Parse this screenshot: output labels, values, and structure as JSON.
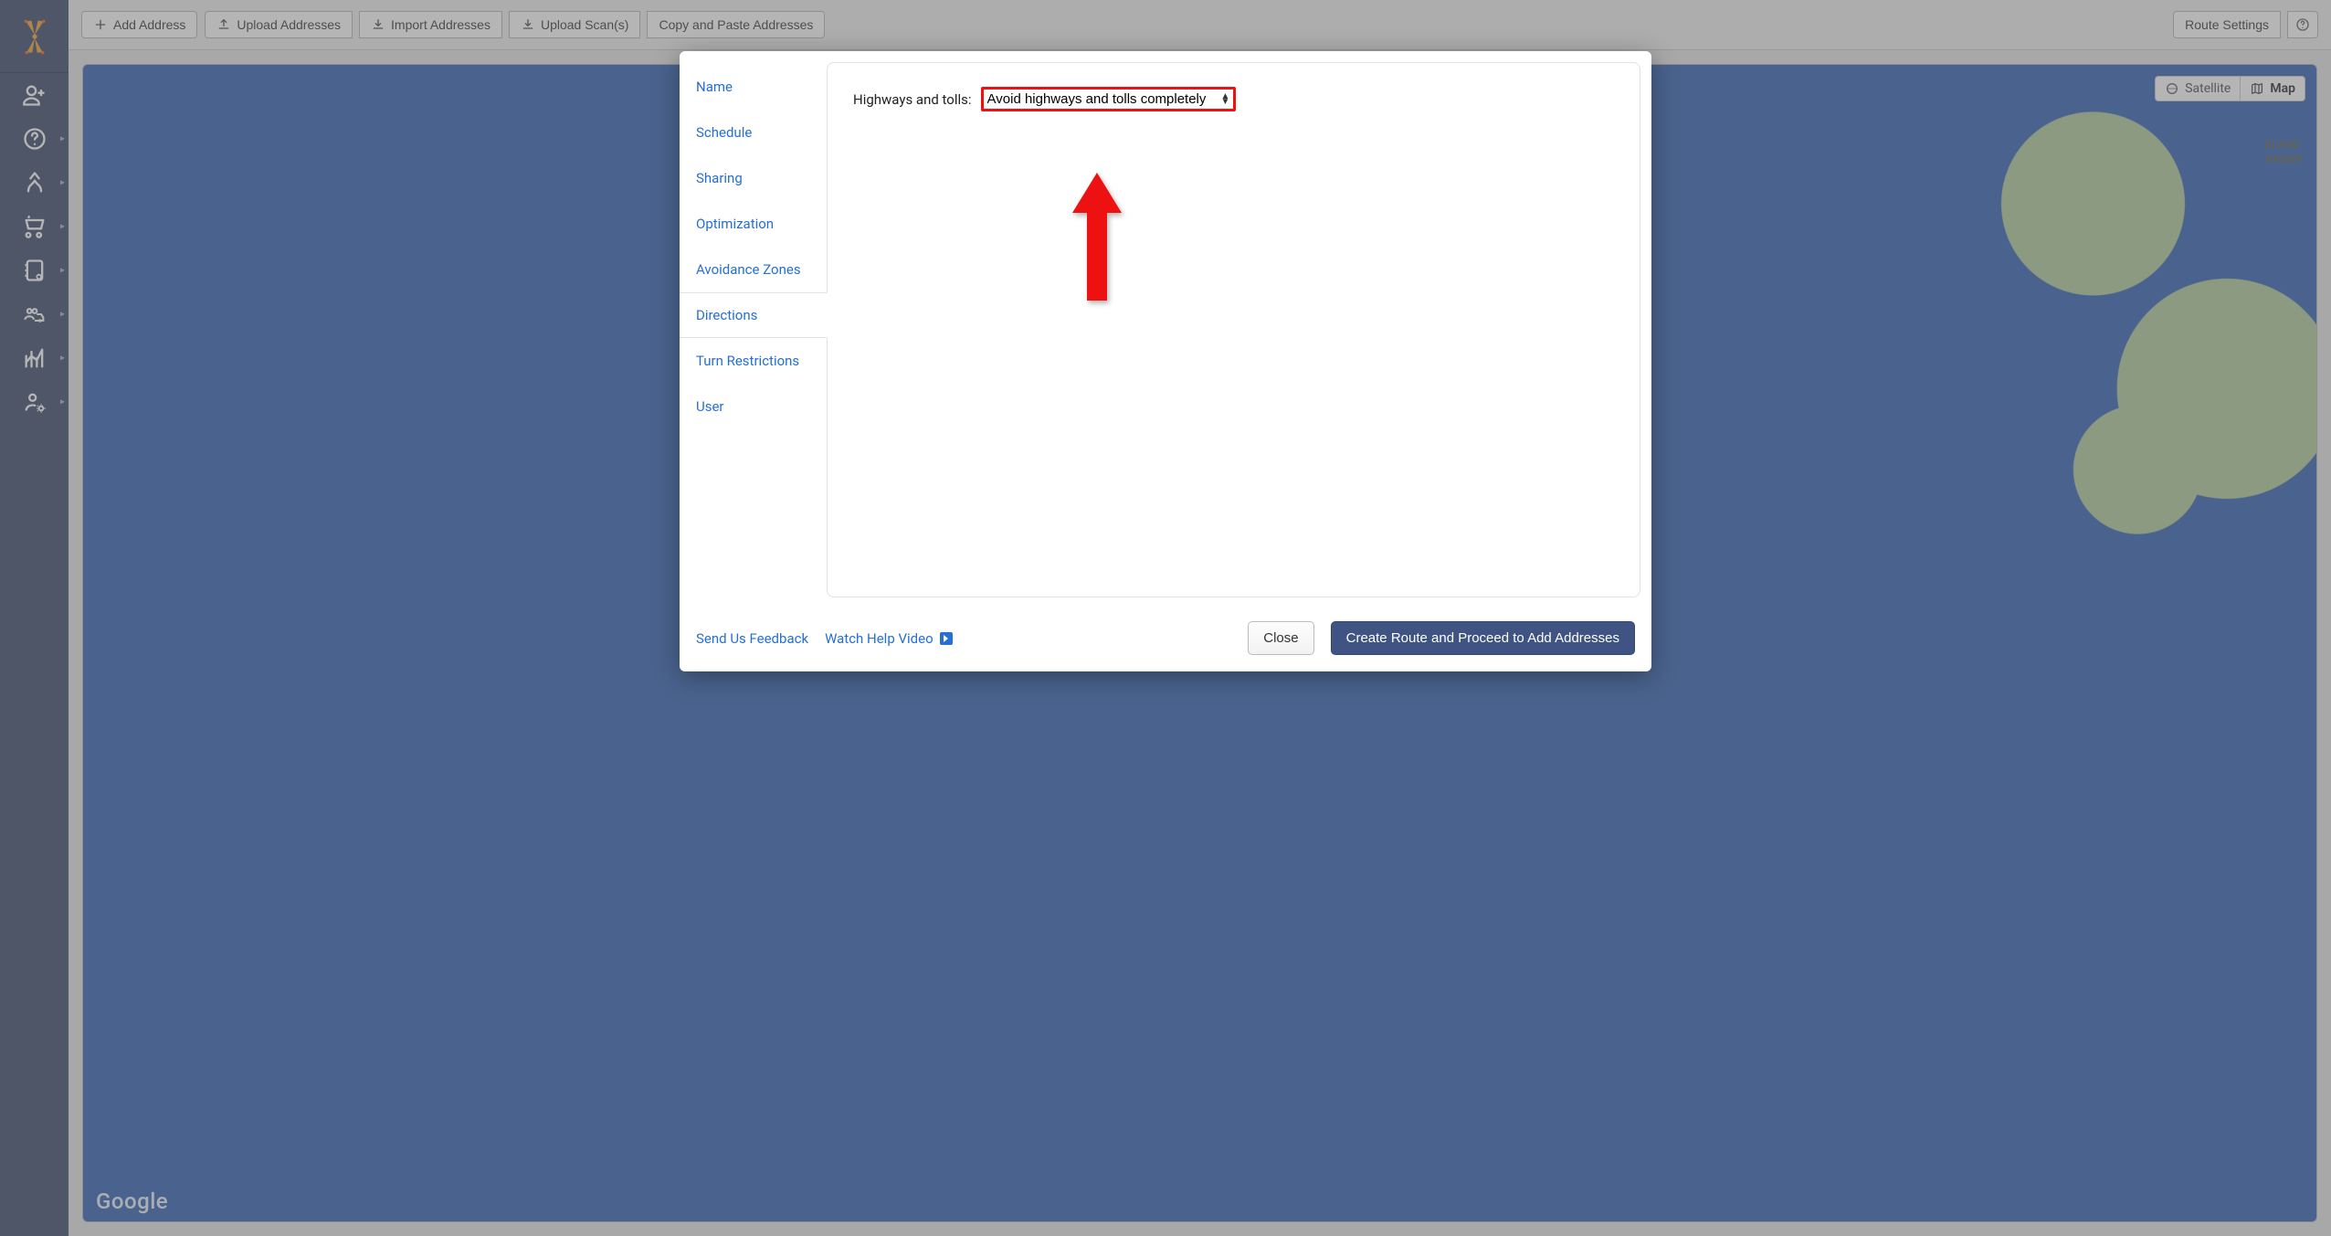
{
  "toolbar": {
    "add_address": "Add Address",
    "upload_addresses": "Upload Addresses",
    "import_addresses": "Import Addresses",
    "upload_scan": "Upload Scan(s)",
    "copy_paste": "Copy and Paste Addresses",
    "route_settings": "Route Settings"
  },
  "map": {
    "satellite": "Satellite",
    "map": "Map",
    "label1": "DLAND",
    "label2": "RADOR",
    "attribution": "Google"
  },
  "modal": {
    "tabs": {
      "name": "Name",
      "schedule": "Schedule",
      "sharing": "Sharing",
      "optimization": "Optimization",
      "avoidance": "Avoidance Zones",
      "directions": "Directions",
      "turn": "Turn Restrictions",
      "user": "User"
    },
    "directions": {
      "label": "Highways and tolls:",
      "selected": "Avoid highways and tolls completely"
    },
    "footer": {
      "feedback": "Send Us Feedback",
      "watch": "Watch Help Video",
      "close": "Close",
      "primary": "Create Route and Proceed to Add Addresses"
    }
  }
}
